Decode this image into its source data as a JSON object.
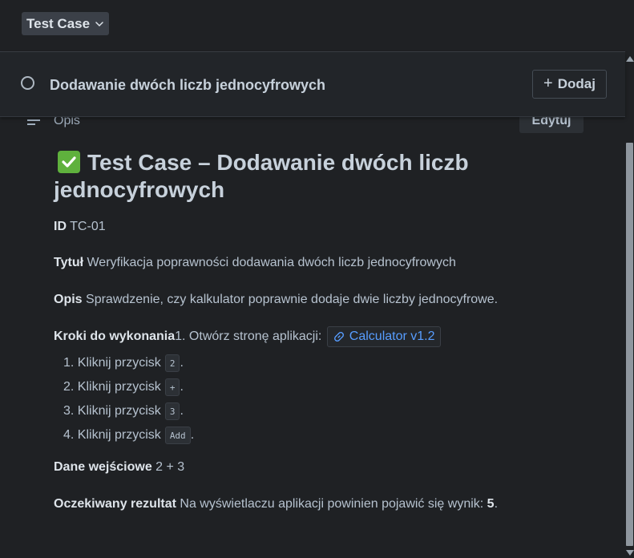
{
  "topbar": {
    "type_label": "Test Case",
    "type_chevron_icon": "chevron-down-icon"
  },
  "header": {
    "status_icon": "circle-outline-icon",
    "title": "Dodawanie dwóch liczb jednocyfrowych",
    "add_label": "Dodaj",
    "add_icon": "plus-icon"
  },
  "section": {
    "icon": "lines-icon",
    "label": "Opis",
    "edit_label": "Edytuj"
  },
  "content": {
    "heading": "Test Case – Dodawanie dwóch liczb jednocyfrowych",
    "heading_emoji": "check-mark-icon",
    "id": {
      "label": "ID",
      "value": "TC-01"
    },
    "tytul": {
      "label": "Tytuł",
      "value": "Weryfikacja poprawności dodawania dwóch liczb jednocyfrowych"
    },
    "opis": {
      "label": "Opis",
      "value": "Sprawdzenie, czy kalkulator poprawnie dodaje dwie liczby jednocyfrowe."
    },
    "kroki": {
      "label": "Kroki do wykonania",
      "first": "1. Otwórz stronę aplikacji:",
      "link": "Calculator v1.2",
      "steps": [
        {
          "text": "1. Kliknij przycisk",
          "code": "2",
          "suffix": "."
        },
        {
          "text": "2. Kliknij przycisk",
          "code": "+",
          "suffix": "."
        },
        {
          "text": "3. Kliknij przycisk",
          "code": "3",
          "suffix": "."
        },
        {
          "text": "4. Kliknij przycisk",
          "code": "Add",
          "suffix": "."
        }
      ]
    },
    "dane": {
      "label": "Dane wejściowe",
      "value": "2 + 3"
    },
    "rezultat": {
      "label": "Oczekiwany rezultat",
      "value": "Na wyświetlaczu aplikacji powinien pojawić się wynik: ",
      "bold_value": "5",
      "suffix": "."
    }
  },
  "colors": {
    "background": "#1f2124",
    "link": "#579dff",
    "check": "#5fb13d"
  }
}
